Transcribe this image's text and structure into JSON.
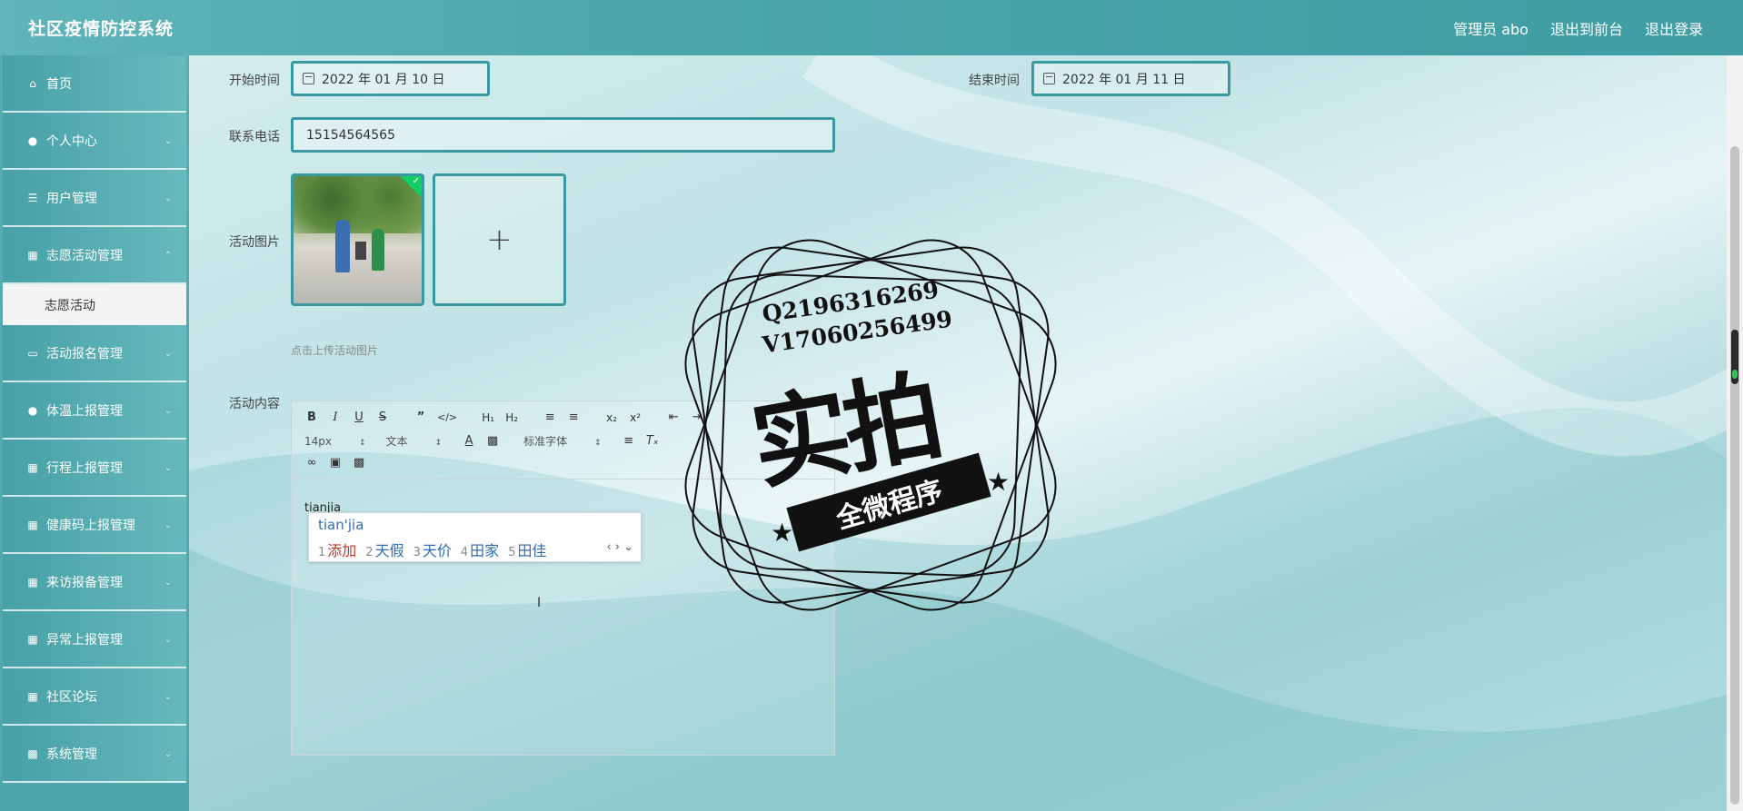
{
  "header": {
    "title": "社区疫情防控系统",
    "admin": "管理员 abo",
    "back_front": "退出到前台",
    "logout": "退出登录"
  },
  "sidebar": {
    "items": [
      {
        "label": "首页",
        "icon": "home-icon"
      },
      {
        "label": "个人中心",
        "icon": "user-icon"
      },
      {
        "label": "用户管理",
        "icon": "list-icon"
      },
      {
        "label": "志愿活动管理",
        "icon": "grid-icon"
      },
      {
        "label": "活动报名管理",
        "icon": "monitor-icon"
      },
      {
        "label": "体温上报管理",
        "icon": "user-icon"
      },
      {
        "label": "行程上报管理",
        "icon": "grid-icon"
      },
      {
        "label": "健康码上报管理",
        "icon": "grid-icon"
      },
      {
        "label": "来访报备管理",
        "icon": "grid-icon"
      },
      {
        "label": "异常上报管理",
        "icon": "grid-icon"
      },
      {
        "label": "社区论坛",
        "icon": "grid-icon"
      },
      {
        "label": "系统管理",
        "icon": "settings-icon"
      }
    ],
    "sub_item": "志愿活动"
  },
  "form": {
    "start_label": "开始时间",
    "start_value": "2022 年 01 月 10 日",
    "end_label": "结束时间",
    "end_value": "2022 年 01 月 11 日",
    "phone_label": "联系电话",
    "phone_value": "15154564565",
    "image_label": "活动图片",
    "upload_tip": "点击上传活动图片",
    "content_label": "活动内容"
  },
  "editor": {
    "font_size": "14px",
    "paragraph": "文本",
    "font_family": "标准字体",
    "text": "tianjia"
  },
  "ime": {
    "input": "tian'jia",
    "candidates": [
      {
        "n": "1",
        "w": "添加"
      },
      {
        "n": "2",
        "w": "天假"
      },
      {
        "n": "3",
        "w": "天价"
      },
      {
        "n": "4",
        "w": "田家"
      },
      {
        "n": "5",
        "w": "田佳"
      }
    ]
  },
  "watermark": {
    "line1": "Q2196316269",
    "line2": "V17060256499",
    "big": "实拍",
    "ribbon": "全微程序"
  }
}
